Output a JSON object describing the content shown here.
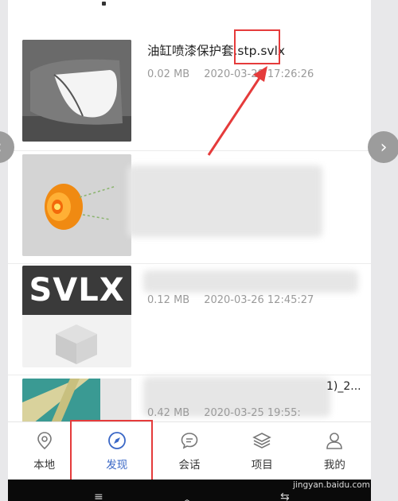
{
  "files": [
    {
      "name": "油缸喷漆保护套.stp.svlx",
      "size": "0.02 MB",
      "date": "2020-03-28 17:26:26",
      "thumb_icon": "part-icon"
    },
    {
      "name": "",
      "size": "",
      "date": "",
      "thumb_icon": "gear-icon"
    },
    {
      "name": "",
      "size": "0.12 MB",
      "date": "2020-03-26 12:45:27",
      "thumb_icon": "svlx-icon",
      "thumb_label": "SVLX"
    },
    {
      "name": "1)_2...",
      "size": "0.42 MB",
      "date": "2020-03-25 19:55:",
      "thumb_icon": "structure-icon"
    }
  ],
  "nav": {
    "tabs": [
      {
        "label": "本地",
        "icon": "location-pin-icon"
      },
      {
        "label": "发现",
        "icon": "compass-icon",
        "active": true
      },
      {
        "label": "会话",
        "icon": "chat-bubble-icon"
      },
      {
        "label": "项目",
        "icon": "layers-icon"
      },
      {
        "label": "我的",
        "icon": "person-icon"
      }
    ]
  },
  "watermark": "jingyan.baidu.com",
  "colors": {
    "accent": "#3a67c6",
    "annotation": "#e53b3b",
    "thumb_orange": "#f08a12"
  }
}
